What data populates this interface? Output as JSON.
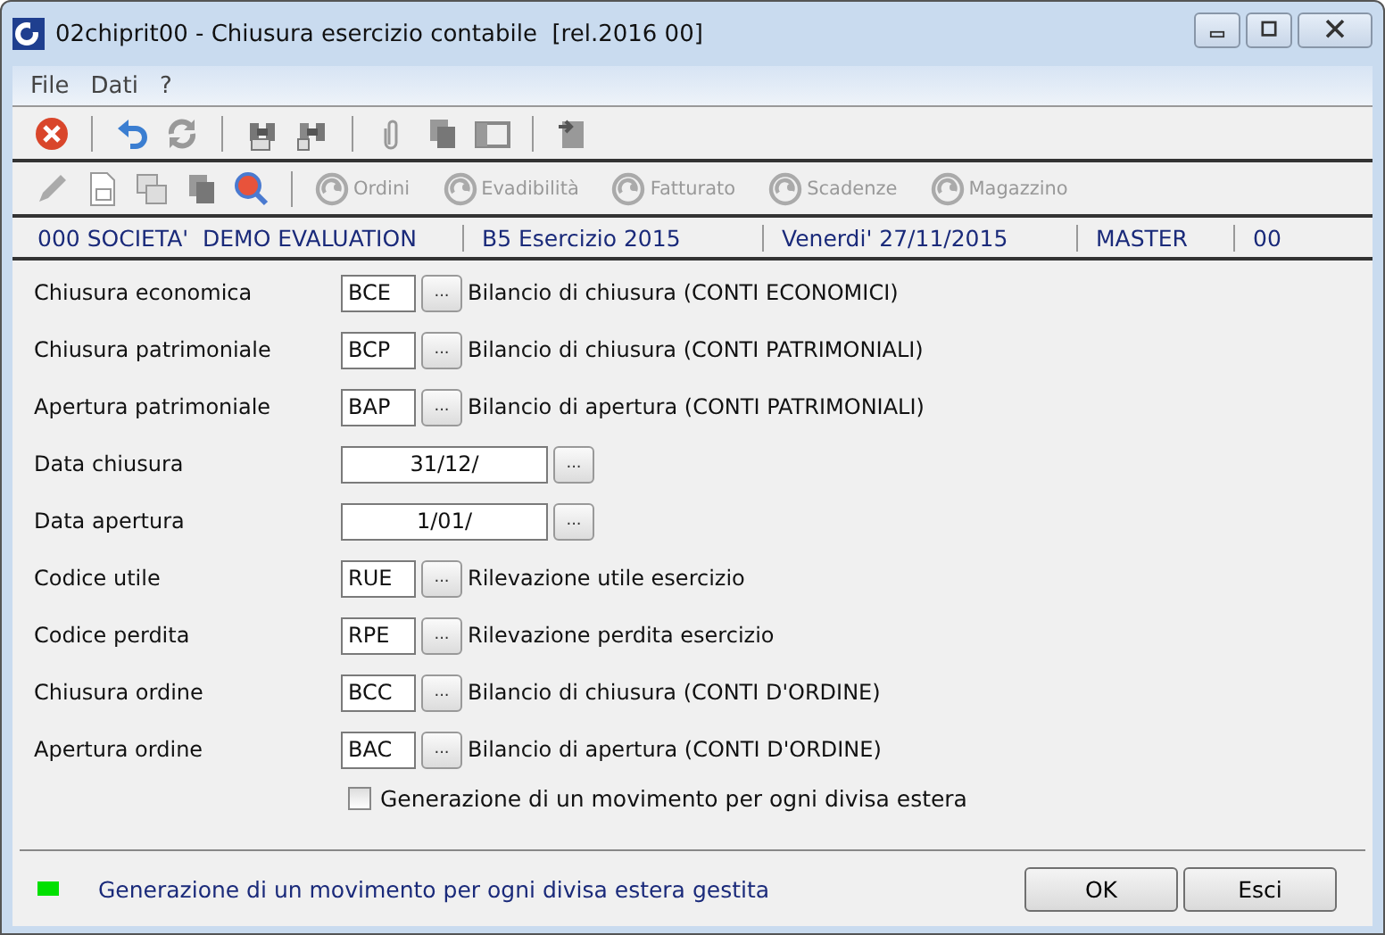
{
  "window": {
    "title": "02chiprit00 - Chiusura esercizio contabile  [rel.2016 00]"
  },
  "menu": [
    {
      "label": "File"
    },
    {
      "label": "Dati"
    },
    {
      "label": "?"
    }
  ],
  "toolbar_actions": [
    {
      "label": "Ordini",
      "disabled": true
    },
    {
      "label": "Evadibilità",
      "disabled": true
    },
    {
      "label": "Fatturato",
      "disabled": true
    },
    {
      "label": "Scadenze",
      "disabled": true
    },
    {
      "label": "Magazzino",
      "disabled": true
    }
  ],
  "info_bar": [
    "000 SOCIETA'  DEMO EVALUATION",
    "B5 Esercizio 2015",
    "Venerdi' 27/11/2015",
    "MASTER",
    "00"
  ],
  "fields": [
    {
      "kind": "code",
      "label": "Chiusura economica",
      "value": "BCE",
      "button_label": "...",
      "description": "Bilancio di chiusura (CONTI ECONOMICI)"
    },
    {
      "kind": "code",
      "label": "Chiusura patrimoniale",
      "value": "BCP",
      "button_label": "...",
      "description": "Bilancio di chiusura (CONTI PATRIMONIALI)"
    },
    {
      "kind": "code",
      "label": "Apertura patrimoniale",
      "value": "BAP",
      "button_label": "...",
      "description": "Bilancio di apertura (CONTI PATRIMONIALI)"
    },
    {
      "kind": "date",
      "label": "Data chiusura",
      "value": "31/12/",
      "button_label": "..."
    },
    {
      "kind": "date",
      "label": "Data apertura",
      "value": "1/01/",
      "button_label": "..."
    },
    {
      "kind": "code",
      "label": "Codice utile",
      "value": "RUE",
      "button_label": "...",
      "description": "Rilevazione utile esercizio"
    },
    {
      "kind": "code",
      "label": "Codice perdita",
      "value": "RPE",
      "button_label": "...",
      "description": "Rilevazione perdita esercizio"
    },
    {
      "kind": "code",
      "label": "Chiusura ordine",
      "value": "BCC",
      "button_label": "...",
      "description": "Bilancio di chiusura (CONTI D'ORDINE)"
    },
    {
      "kind": "code",
      "label": "Apertura ordine",
      "value": "BAC",
      "button_label": "...",
      "description": "Bilancio di apertura (CONTI D'ORDINE)"
    }
  ],
  "option": {
    "label": "Generazione di un movimento per ogni divisa estera",
    "checked": false
  },
  "status": {
    "color": "#00e000",
    "message": "Generazione di un movimento per ogni divisa estera gestita"
  },
  "buttons": [
    {
      "label": "OK"
    },
    {
      "label": "Esci"
    }
  ]
}
